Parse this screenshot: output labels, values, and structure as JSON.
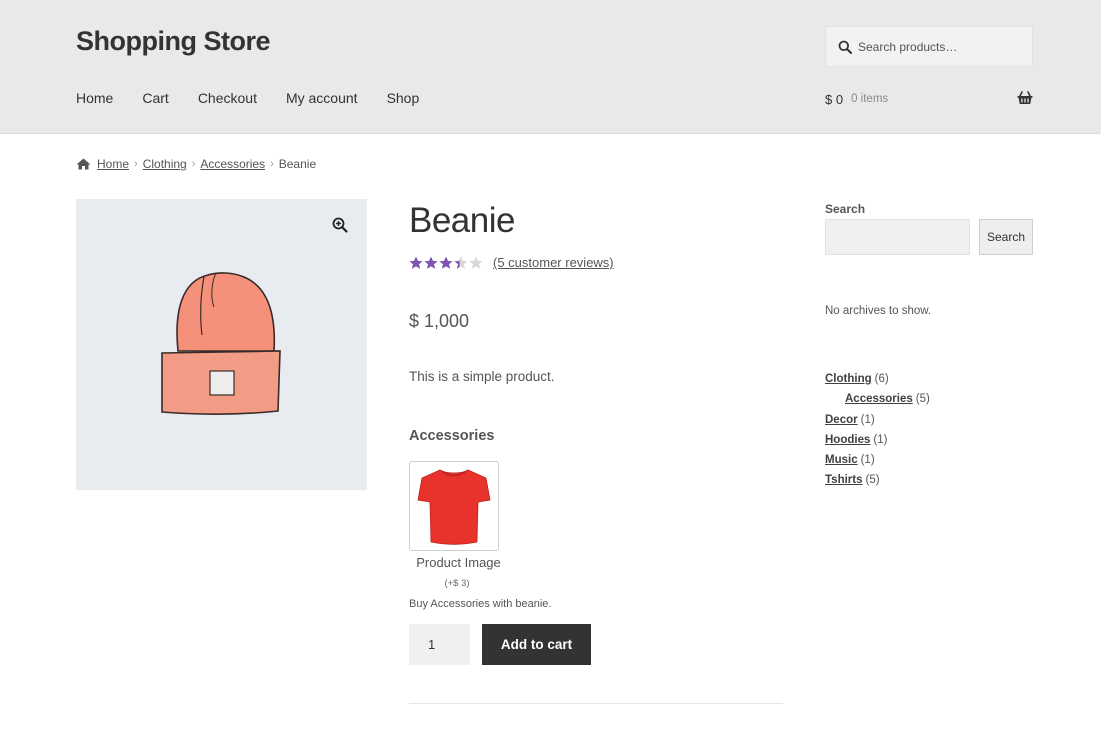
{
  "header": {
    "site_title": "Shopping Store",
    "search_placeholder": "Search products…",
    "nav": [
      "Home",
      "Cart",
      "Checkout",
      "My account",
      "Shop"
    ],
    "cart_total": "$ 0",
    "cart_count": "0 items"
  },
  "breadcrumb": {
    "items": [
      "Home",
      "Clothing",
      "Accessories"
    ],
    "current": "Beanie"
  },
  "product": {
    "title": "Beanie",
    "rating": 3.4,
    "rating_max": 5,
    "reviews_label": "(5 customer reviews)",
    "price": "$ 1,000",
    "description": "This is a simple product.",
    "addon_heading": "Accessories",
    "addon_name": "Product Image",
    "addon_price": "(+$ 3)",
    "addon_description": "Buy Accessories with beanie.",
    "quantity": "1",
    "add_to_cart_label": "Add to cart"
  },
  "sidebar": {
    "search_label": "Search",
    "search_button": "Search",
    "no_archives": "No archives to show.",
    "categories": [
      {
        "name": "Clothing",
        "count": "(6)"
      },
      {
        "name": "Accessories",
        "count": "(5)"
      },
      {
        "name": "Decor",
        "count": "(1)"
      },
      {
        "name": "Hoodies",
        "count": "(1)"
      },
      {
        "name": "Music",
        "count": "(1)"
      },
      {
        "name": "Tshirts",
        "count": "(5)"
      }
    ]
  },
  "colors": {
    "header_bg": "#e9e9e9",
    "star": "#7f54b3",
    "button_bg": "#333333",
    "image_bg": "#e8ecf1",
    "beanie": "#f5917a"
  },
  "icons": [
    "search-icon",
    "basket-icon",
    "home-icon",
    "zoom-icon",
    "star-icon"
  ]
}
